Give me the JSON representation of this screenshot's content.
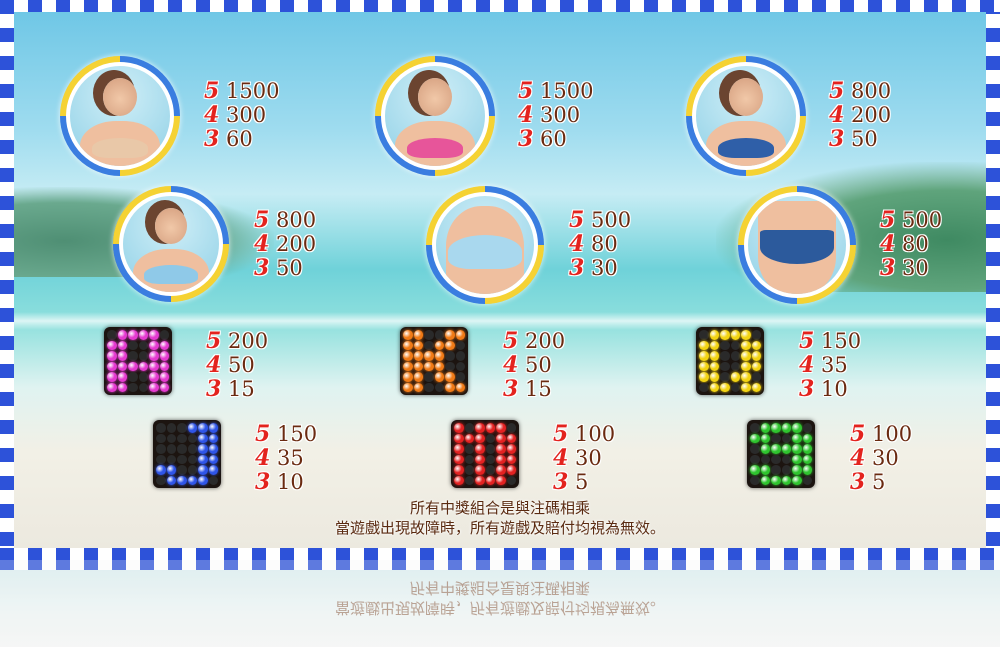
{
  "colors": {
    "border_blue": "#2d52d9",
    "pay_count_red": "#e3231e",
    "pay_value_brown": "#6a2a10"
  },
  "symbols": [
    {
      "id": "girl-1",
      "kind": "portrait",
      "bikini_color": "#e9c8a8",
      "pays": [
        {
          "count": "5",
          "value": "1500"
        },
        {
          "count": "4",
          "value": "300"
        },
        {
          "count": "3",
          "value": "60"
        }
      ]
    },
    {
      "id": "girl-2",
      "kind": "portrait",
      "bikini_color": "#e7559a",
      "pays": [
        {
          "count": "5",
          "value": "1500"
        },
        {
          "count": "4",
          "value": "300"
        },
        {
          "count": "3",
          "value": "60"
        }
      ]
    },
    {
      "id": "girl-3",
      "kind": "portrait",
      "bikini_color": "#2f5fa8",
      "pays": [
        {
          "count": "5",
          "value": "800"
        },
        {
          "count": "4",
          "value": "200"
        },
        {
          "count": "3",
          "value": "50"
        }
      ]
    },
    {
      "id": "girl-4",
      "kind": "portrait",
      "bikini_color": "#8fc9e8",
      "pays": [
        {
          "count": "5",
          "value": "800"
        },
        {
          "count": "4",
          "value": "200"
        },
        {
          "count": "3",
          "value": "50"
        }
      ]
    },
    {
      "id": "bikini-top",
      "kind": "portrait",
      "bikini_color": "#a9d8ee",
      "pays": [
        {
          "count": "5",
          "value": "500"
        },
        {
          "count": "4",
          "value": "80"
        },
        {
          "count": "3",
          "value": "30"
        }
      ]
    },
    {
      "id": "bikini-bottom",
      "kind": "portrait",
      "bikini_color": "#2c5a9c",
      "pays": [
        {
          "count": "5",
          "value": "500"
        },
        {
          "count": "4",
          "value": "80"
        },
        {
          "count": "3",
          "value": "30"
        }
      ]
    },
    {
      "id": "letter-a",
      "kind": "tile",
      "letter": "A",
      "led_color": "#e43ad0",
      "pays": [
        {
          "count": "5",
          "value": "200"
        },
        {
          "count": "4",
          "value": "50"
        },
        {
          "count": "3",
          "value": "15"
        }
      ]
    },
    {
      "id": "letter-k",
      "kind": "tile",
      "letter": "K",
      "led_color": "#f07a16",
      "pays": [
        {
          "count": "5",
          "value": "200"
        },
        {
          "count": "4",
          "value": "50"
        },
        {
          "count": "3",
          "value": "15"
        }
      ]
    },
    {
      "id": "letter-q",
      "kind": "tile",
      "letter": "Q",
      "led_color": "#f2d312",
      "pays": [
        {
          "count": "5",
          "value": "150"
        },
        {
          "count": "4",
          "value": "35"
        },
        {
          "count": "3",
          "value": "10"
        }
      ]
    },
    {
      "id": "letter-j",
      "kind": "tile",
      "letter": "J",
      "led_color": "#2f55e8",
      "pays": [
        {
          "count": "5",
          "value": "150"
        },
        {
          "count": "4",
          "value": "35"
        },
        {
          "count": "3",
          "value": "10"
        }
      ]
    },
    {
      "id": "number-10",
      "kind": "tile",
      "letter": "10",
      "led_color": "#e32222",
      "pays": [
        {
          "count": "5",
          "value": "100"
        },
        {
          "count": "4",
          "value": "30"
        },
        {
          "count": "3",
          "value": "5"
        }
      ]
    },
    {
      "id": "letter-9",
      "kind": "tile",
      "letter": "9",
      "led_color": "#2fc42f",
      "pays": [
        {
          "count": "5",
          "value": "100"
        },
        {
          "count": "4",
          "value": "30"
        },
        {
          "count": "3",
          "value": "5"
        }
      ]
    }
  ],
  "notes": {
    "line1": "所有中獎組合是與注碼相乘",
    "line2": "當遊戲出現故障時，所有遊戲及賠付均視為無效。"
  }
}
